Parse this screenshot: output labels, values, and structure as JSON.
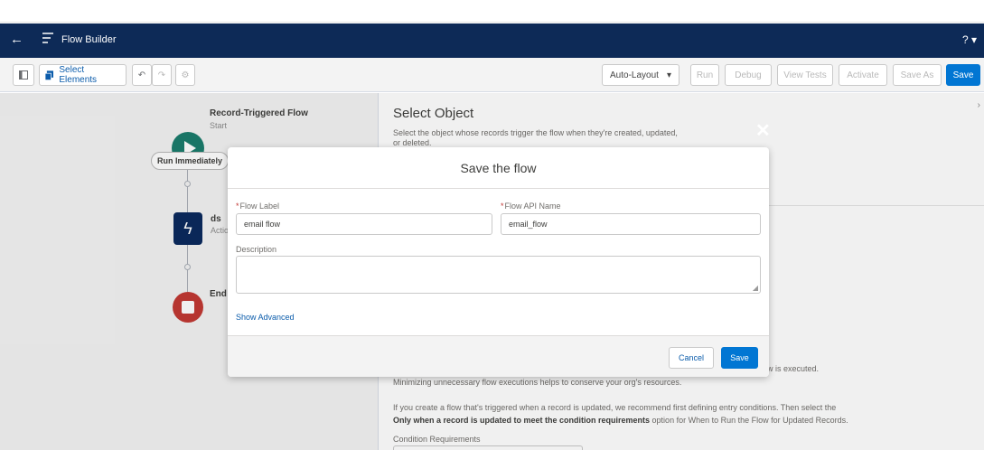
{
  "header": {
    "title": "Flow Builder",
    "back_icon": "back-arrow-icon",
    "help": "? ▾"
  },
  "toolbar": {
    "select_elements": "Select Elements",
    "layout": "Auto-Layout",
    "run": "Run",
    "debug": "Debug",
    "view_tests": "View Tests",
    "activate": "Activate",
    "save_as": "Save As",
    "save": "Save"
  },
  "canvas": {
    "start_title": "Record-Triggered Flow",
    "start_sub": "Start",
    "run_pill": "Run Immediately",
    "action_title": "ds",
    "action_sub": "Actio",
    "end_title": "End"
  },
  "panel": {
    "title": "Select Object",
    "description": "Select the object whose records trigger the flow when they're created, updated, or deleted.",
    "executed_tail": "w is executed.",
    "minimize_text": "Minimizing unnecessary flow executions helps to conserve your org's resources.",
    "rec_line1": "If you create a flow that's triggered when a record is updated, we recommend first defining entry conditions. Then select the",
    "rec_bold": "Only when a record is updated to meet the condition requirements",
    "rec_line2_tail": " option for When to Run the Flow for Updated Records.",
    "condition_label": "Condition Requirements"
  },
  "modal": {
    "title": "Save the flow",
    "flow_label_label": "Flow Label",
    "flow_label_value": "email flow",
    "api_name_label": "Flow API Name",
    "api_name_value": "email_flow",
    "description_label": "Description",
    "description_value": "",
    "required_mark": "*",
    "show_advanced": "Show Advanced",
    "cancel": "Cancel",
    "save": "Save",
    "close": "✕"
  },
  "colors": {
    "header_bg": "#0d2a57",
    "brand_blue": "#0176d3",
    "start_green": "#1b7d6d",
    "end_red": "#c23934",
    "action_navy": "#0b2a5e"
  }
}
